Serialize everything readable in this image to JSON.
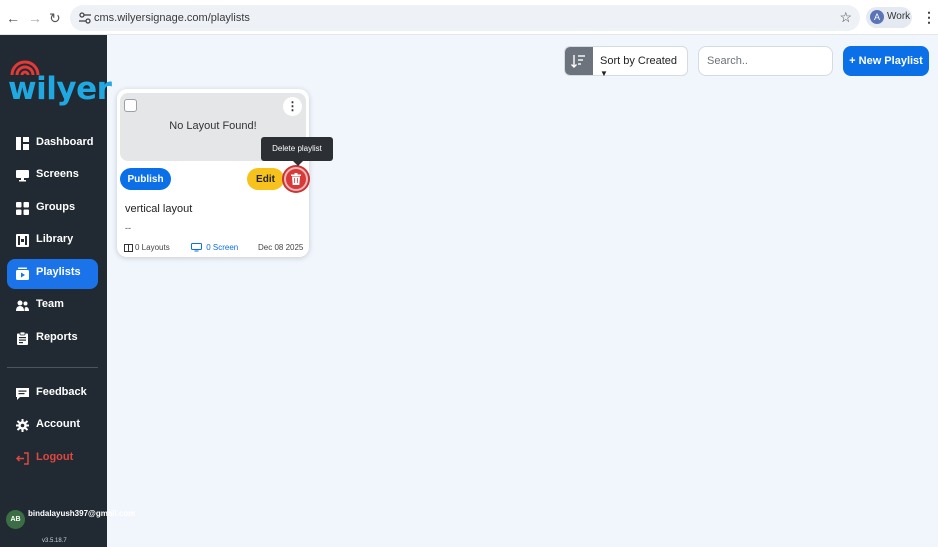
{
  "browser": {
    "url": "cms.wilyersignage.com/playlists",
    "profile_initial": "A",
    "profile_label": "Work"
  },
  "sidebar": {
    "logo_text": "wilyer",
    "items": [
      {
        "label": "Dashboard",
        "icon": "dashboard-icon"
      },
      {
        "label": "Screens",
        "icon": "monitor-icon"
      },
      {
        "label": "Groups",
        "icon": "groups-icon"
      },
      {
        "label": "Library",
        "icon": "library-icon"
      },
      {
        "label": "Playlists",
        "icon": "playlist-icon",
        "active": true
      },
      {
        "label": "Team",
        "icon": "team-icon"
      },
      {
        "label": "Reports",
        "icon": "clipboard-icon"
      }
    ],
    "footer_items": [
      {
        "label": "Feedback",
        "icon": "feedback-icon"
      },
      {
        "label": "Account",
        "icon": "gear-icon"
      },
      {
        "label": "Logout",
        "icon": "logout-icon"
      }
    ],
    "user": {
      "initials": "AB",
      "email": "bindalayush397@gmail.com"
    },
    "version": "v3.5.18.7"
  },
  "toolbar": {
    "sort_label": "Sort by Created",
    "search_placeholder": "Search..",
    "new_playlist_label": "+ New Playlist"
  },
  "playlist_card": {
    "thumbnail_message": "No Layout Found!",
    "publish_label": "Publish",
    "edit_label": "Edit",
    "title": "vertical layout",
    "description": "--",
    "layouts": "0 Layouts",
    "screens": "0 Screen",
    "date": "Dec 08 2025"
  },
  "tooltip": {
    "text": "Delete playlist"
  },
  "colors": {
    "sidebar_bg": "#212a33",
    "accent": "#0b6fe8",
    "edit": "#f7c21c",
    "delete": "#d83a3a",
    "page_bg": "#f1f6fd"
  }
}
